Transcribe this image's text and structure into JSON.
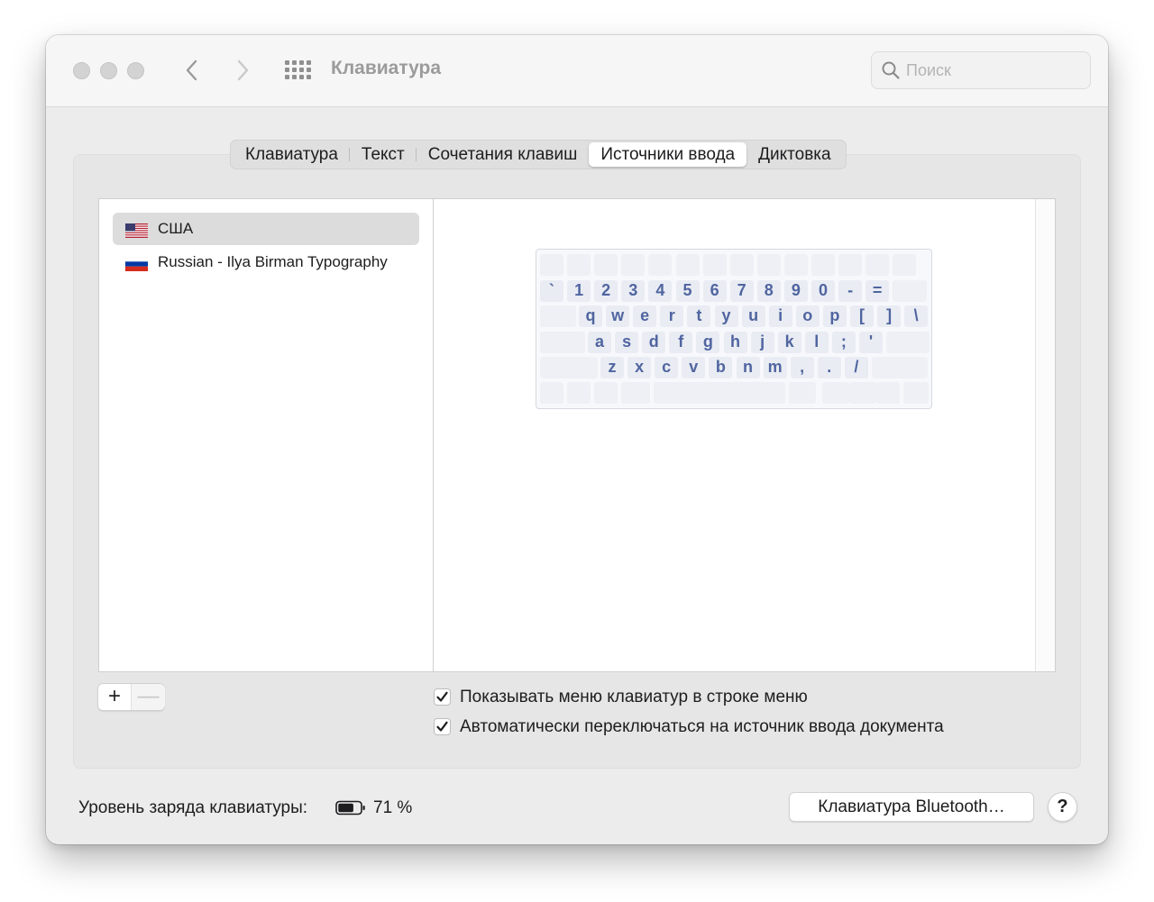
{
  "window": {
    "title": "Клавиатура"
  },
  "search": {
    "placeholder": "Поиск"
  },
  "tabs": [
    {
      "label": "Клавиатура",
      "active": false
    },
    {
      "label": "Текст",
      "active": false
    },
    {
      "label": "Сочетания клавиш",
      "active": false
    },
    {
      "label": "Источники ввода",
      "active": true
    },
    {
      "label": "Диктовка",
      "active": false
    }
  ],
  "input_sources": [
    {
      "label": "США",
      "flag": "us-flag-icon",
      "selected": true
    },
    {
      "label": "Russian - Ilya Birman Typography",
      "flag": "ru-flag-icon",
      "selected": false
    }
  ],
  "keyboard_layout": {
    "row1": [
      "`",
      "1",
      "2",
      "3",
      "4",
      "5",
      "6",
      "7",
      "8",
      "9",
      "0",
      "-",
      "="
    ],
    "row2": [
      "q",
      "w",
      "e",
      "r",
      "t",
      "y",
      "u",
      "i",
      "o",
      "p",
      "[",
      "]",
      "\\"
    ],
    "row3": [
      "a",
      "s",
      "d",
      "f",
      "g",
      "h",
      "j",
      "k",
      "l",
      ";",
      "'"
    ],
    "row4": [
      "z",
      "x",
      "c",
      "v",
      "b",
      "n",
      "m",
      ",",
      ".",
      "/"
    ]
  },
  "list_buttons": {
    "add": "+",
    "remove": "—"
  },
  "options": {
    "show_menu": {
      "label": "Показывать меню клавиатур в строке меню",
      "checked": true
    },
    "auto_switch": {
      "label": "Автоматически переключаться на источник ввода документа",
      "checked": true
    }
  },
  "battery": {
    "label": "Уровень заряда клавиатуры:",
    "value": "71 %",
    "level": 0.71
  },
  "bluetooth_button": "Клавиатура Bluetooth…",
  "help_button": "?",
  "colors": {
    "key_text": "#5065a0",
    "key_bg": "#e9ecf3",
    "selection": "#dcdcdc"
  }
}
